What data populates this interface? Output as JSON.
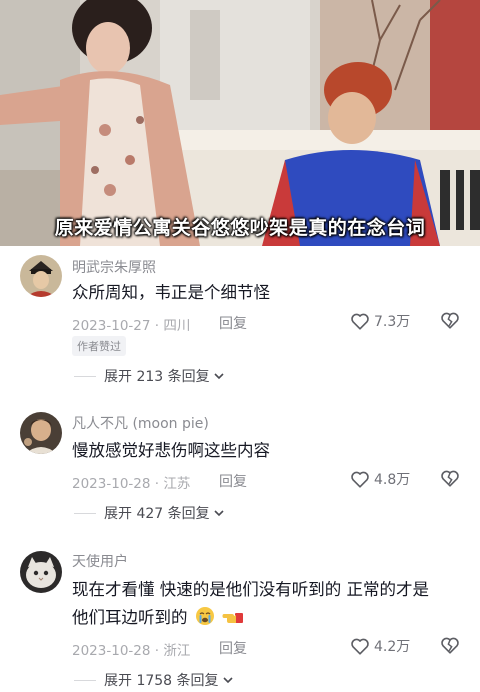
{
  "video": {
    "subtitle": "原来爱情公寓关谷悠悠吵架是真的在念台词"
  },
  "comments": [
    {
      "username": "明武宗朱厚照",
      "content": "众所周知，韦正是个细节怪",
      "date_location": "2023-10-27 · 四川",
      "reply_label": "回复",
      "likes": "7.3万",
      "badge": "作者赞过",
      "expand_label": "展开 213 条回复"
    },
    {
      "username": "凡人不凡 (moon pie)",
      "content": "慢放感觉好悲伤啊这些内容",
      "date_location": "2023-10-28 · 江苏",
      "reply_label": "回复",
      "likes": "4.8万",
      "expand_label": "展开 427 条回复"
    },
    {
      "username": "天使用户",
      "content_line1": "现在才看懂 快速的是他们没有听到的 正常的才是",
      "content_line2": "他们耳边听到的",
      "date_location": "2023-10-28 · 浙江",
      "reply_label": "回复",
      "likes": "4.2万",
      "expand_label": "展开 1758 条回复"
    }
  ],
  "icons": {
    "like": "heart-outline-icon",
    "dislike": "broken-heart-icon",
    "expand": "chevron-down-icon"
  },
  "colors": {
    "text_primary": "#161823",
    "text_secondary": "#8a8b91",
    "text_meta": "#a8a9ae"
  }
}
